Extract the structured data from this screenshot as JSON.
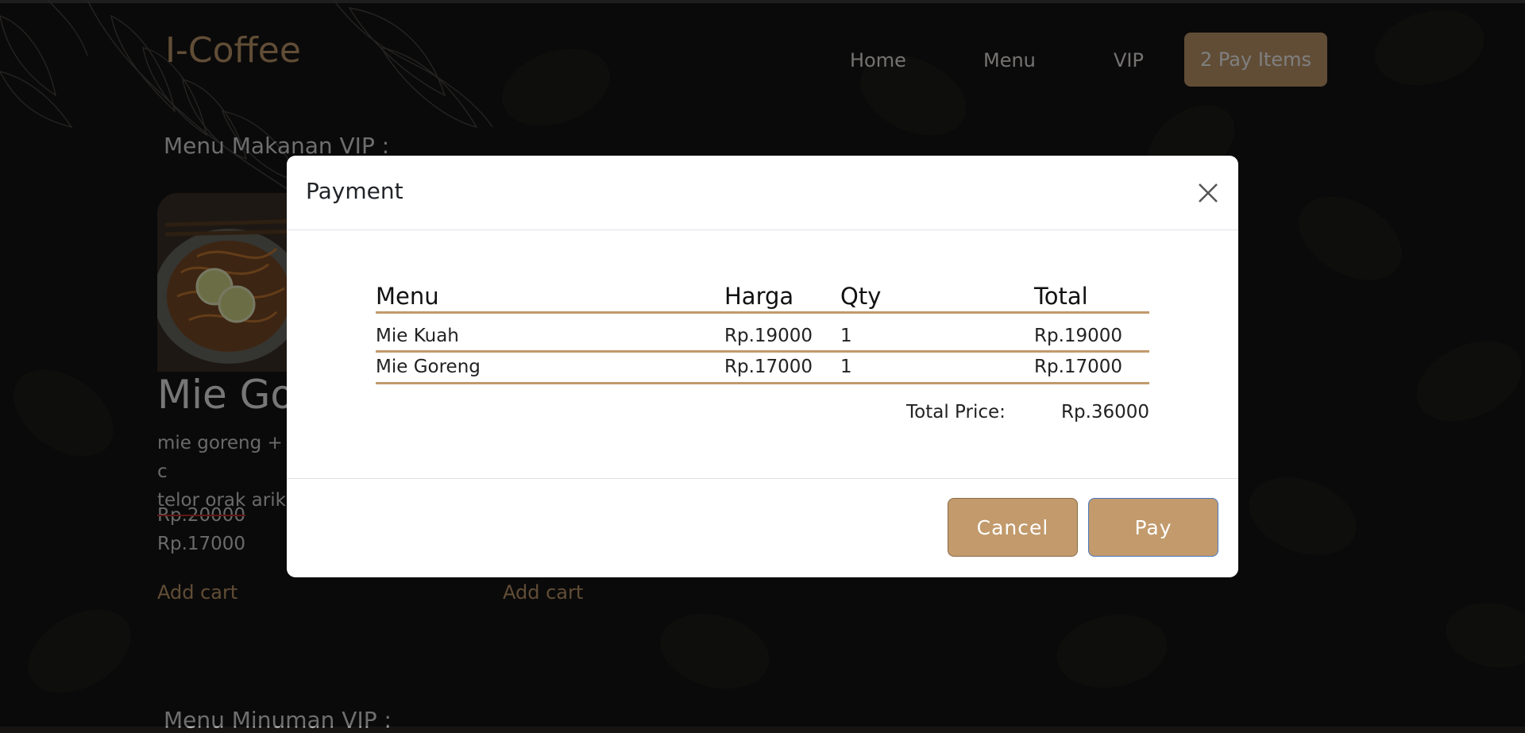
{
  "header": {
    "logo": "I-Coffee",
    "nav": [
      "Home",
      "Menu",
      "VIP"
    ],
    "pay_button": "2 Pay Items"
  },
  "food_section": {
    "title": "Menu Makanan VIP :",
    "item": {
      "name_visible": "Mie Go",
      "description_lines": [
        "mie goreng + c",
        "telor orak arik"
      ],
      "old_price": "Rp.20000",
      "new_price": "Rp.17000",
      "add_cart_label": "Add cart"
    },
    "second_add_cart_label": "Add cart"
  },
  "drink_section": {
    "title": "Menu Minuman VIP :"
  },
  "modal": {
    "title": "Payment",
    "table": {
      "headers": [
        "Menu",
        "Harga",
        "Qty",
        "Total"
      ],
      "rows": [
        [
          "Mie Kuah",
          "Rp.19000",
          "1",
          "Rp.19000"
        ],
        [
          "Mie Goreng",
          "Rp.17000",
          "1",
          "Rp.17000"
        ]
      ]
    },
    "total_label": "Total Price:",
    "total_value": "Rp.36000",
    "cancel_label": "Cancel",
    "pay_label": "Pay"
  },
  "colors": {
    "accent": "#c29a6c",
    "background": "#161514",
    "modal_bg": "#ffffff",
    "strike": "#c0302d"
  },
  "icons": [
    "close-icon",
    "leaf-pattern",
    "coffee-bean-pattern"
  ]
}
